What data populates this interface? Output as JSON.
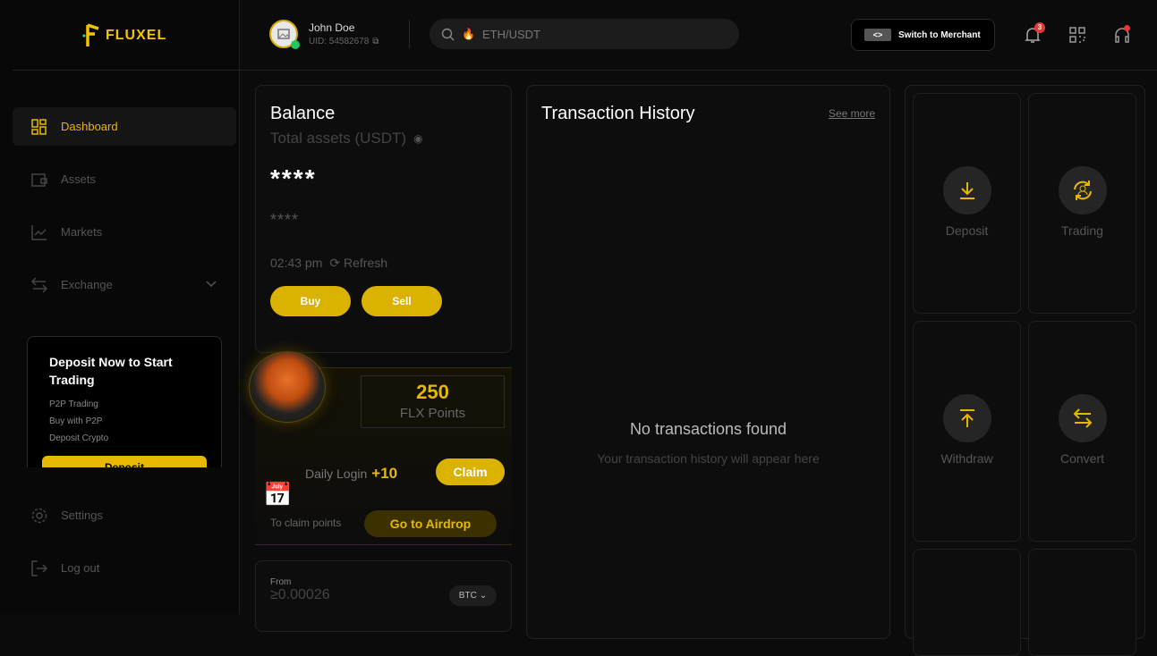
{
  "brand": {
    "name": "FLUXEL"
  },
  "user": {
    "name": "John Doe",
    "uid": "UID: 54582678"
  },
  "search": {
    "value": "ETH/USDT"
  },
  "header": {
    "merchant_label": "Switch to Merchant",
    "notification_count": "3"
  },
  "sidebar": {
    "items": [
      {
        "label": "Dashboard"
      },
      {
        "label": "Assets"
      },
      {
        "label": "Markets"
      },
      {
        "label": "Exchange"
      }
    ],
    "promo": {
      "title": "Deposit Now to Start Trading",
      "lines": [
        "P2P Trading",
        "Buy with P2P",
        "Deposit Crypto"
      ],
      "button": "Deposit"
    },
    "settings": "Settings",
    "logout": "Log out"
  },
  "balance": {
    "title": "Balance",
    "subtitle": "Total assets (USDT)",
    "amount": "****",
    "sub_amount": "****",
    "time": "02:43 pm",
    "refresh": "Refresh",
    "buy": "Buy",
    "sell": "Sell"
  },
  "points": {
    "value": "250",
    "label": "FLX Points",
    "daily_label": "Daily Login",
    "daily_bonus": "+10",
    "claim": "Claim",
    "claim_hint": "To claim points",
    "airdrop": "Go to Airdrop"
  },
  "convert": {
    "from_label": "From",
    "from_value": "≥0.00026",
    "currency": "BTC"
  },
  "transactions": {
    "title": "Transaction History",
    "see_more": "See more",
    "empty_title": "No transactions found",
    "empty_sub": "Your transaction history will appear here"
  },
  "actions": [
    {
      "label": "Deposit"
    },
    {
      "label": "Trading"
    },
    {
      "label": "Withdraw"
    },
    {
      "label": "Convert"
    }
  ],
  "colors": {
    "accent": "#e6b800",
    "background": "#0b0b0b",
    "badge": "#e53935",
    "online": "#22c55e"
  }
}
